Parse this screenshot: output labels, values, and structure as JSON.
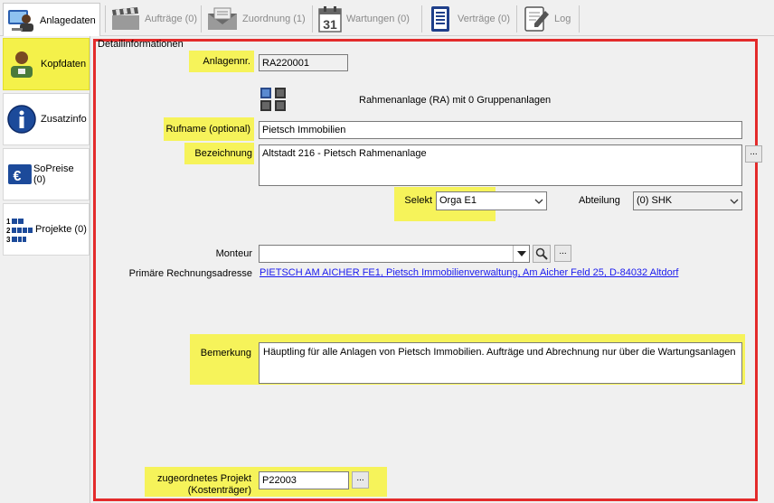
{
  "toolbar": {
    "tabs": [
      {
        "label": "Anlagedaten",
        "icon": "computer-user-icon",
        "active": true
      },
      {
        "label": "Aufträge (0)",
        "icon": "clapperboard-icon",
        "active": false
      },
      {
        "label": "Zuordnung (1)",
        "icon": "envelope-icon",
        "active": false
      },
      {
        "label": "Wartungen (0)",
        "icon": "calendar-31-icon",
        "active": false
      },
      {
        "label": "Verträge (0)",
        "icon": "contract-list-icon",
        "active": false
      },
      {
        "label": "Log",
        "icon": "notebook-pen-icon",
        "active": false
      }
    ]
  },
  "sidebar": {
    "items": [
      {
        "label": "Kopfdaten",
        "icon": "person-icon",
        "active": true
      },
      {
        "label": "Zusatzinfo",
        "icon": "info-icon",
        "active": false
      },
      {
        "label": "SoPreise (0)",
        "icon": "euro-icon",
        "active": false
      },
      {
        "label": "Projekte (0)",
        "icon": "numbered-list-icon",
        "active": false
      }
    ]
  },
  "main": {
    "section_title": "Detailinformationen",
    "anlagennr": {
      "label": "Anlagennr.",
      "value": "RA220001"
    },
    "rahmen_info": "Rahmenanlage (RA) mit 0 Gruppenanlagen",
    "rufname": {
      "label": "Rufname (optional)",
      "value": "Pietsch Immobilien"
    },
    "bezeichnung": {
      "label": "Bezeichnung",
      "value": "Altstadt 216 - Pietsch Rahmenanlage",
      "button": "..."
    },
    "selekt": {
      "label": "Selekt",
      "value": "Orga E1"
    },
    "abteilung": {
      "label": "Abteilung",
      "value": "(0) SHK"
    },
    "monteur": {
      "label": "Monteur",
      "value": "",
      "button": "..."
    },
    "rechnungsadresse": {
      "label": "Primäre Rechnungsadresse",
      "value": "PIETSCH AM AICHER FE1, Pietsch Immobilienverwaltung, Am Aicher Feld 25, D-84032 Altdorf"
    },
    "bemerkung": {
      "label": "Bemerkung",
      "value": "Häuptling für alle Anlagen von Pietsch Immobilien. Aufträge und Abrechnung nur über die Wartungsanlagen"
    },
    "projekt": {
      "label_line1": "zugeordnetes Projekt",
      "label_line2": "(Kostenträger)",
      "value": "P22003",
      "button": "..."
    }
  },
  "colors": {
    "highlight": "#f6f35a",
    "frame": "#e32b2b",
    "link": "#1a1aee"
  }
}
